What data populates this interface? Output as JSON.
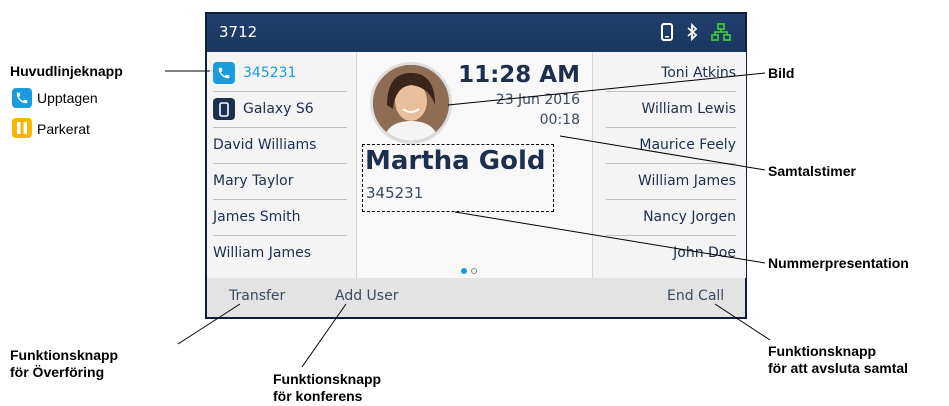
{
  "phone": {
    "extension": "3712",
    "left_lines": [
      {
        "label": "345231",
        "icon": "phone-handset-icon",
        "color": "#1a9be0"
      },
      {
        "label": "Galaxy S6",
        "icon": "mobile-phone-icon",
        "color": "#1c2f4f"
      },
      {
        "label": "David Williams"
      },
      {
        "label": "Mary Taylor"
      },
      {
        "label": "James Smith"
      },
      {
        "label": "William James"
      }
    ],
    "right_lines": [
      "Toni Atkins",
      "William Lewis",
      "Maurice Feely",
      "William James",
      "Nancy Jorgen",
      "John Doe"
    ],
    "call": {
      "time": "11:28 AM",
      "date": "23 Jun 2016",
      "timer": "00:18",
      "caller_name": "Martha Gold",
      "caller_number": "345231"
    },
    "softkeys": {
      "transfer": "Transfer",
      "add_user": "Add User",
      "end_call": "End Call"
    },
    "colors": {
      "accent": "#1a9be0",
      "header": "#1e3a64",
      "network_icon": "#3cc33c",
      "hold": "#f5b800"
    }
  },
  "annotations": {
    "main_line_key": "Huvudlinjeknapp",
    "busy": "Upptagen",
    "parked": "Parkerat",
    "picture": "Bild",
    "call_timer": "Samtalstimer",
    "caller_id": "Nummerpresentation",
    "transfer_key_line1": "Funktionsknapp",
    "transfer_key_line2": "för Överföring",
    "conference_key_line1": "Funktionsknapp",
    "conference_key_line2": "för konferens",
    "endcall_key_line1": "Funktionsknapp",
    "endcall_key_line2": "för att avsluta samtal"
  }
}
